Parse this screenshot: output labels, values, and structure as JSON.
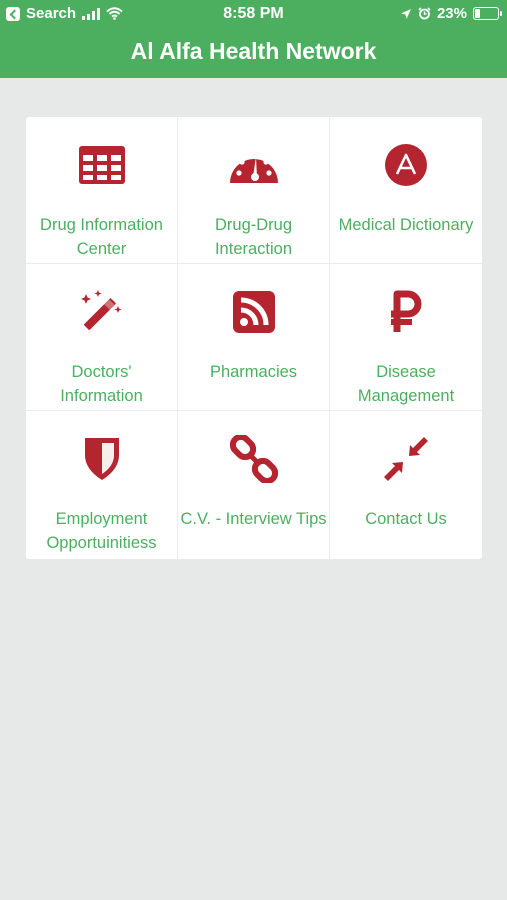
{
  "status_bar": {
    "back_label": "Search",
    "time": "8:58 PM",
    "battery": "23%",
    "battery_level": 0.23
  },
  "header": {
    "title": "Al Alfa Health Network"
  },
  "colors": {
    "accent": "#4caf5f",
    "icon": "#b5252f",
    "background": "#e6e9e8"
  },
  "tiles": [
    {
      "label": "Drug Information\nCenter",
      "icon": "table-icon"
    },
    {
      "label": "Drug-Drug\nInteraction",
      "icon": "dashboard-icon"
    },
    {
      "label": "Medical Dictionary",
      "icon": "angular-icon"
    },
    {
      "label": "Doctors'\nInformation",
      "icon": "magic-wand-icon"
    },
    {
      "label": "Pharmacies",
      "icon": "rss-icon"
    },
    {
      "label": "Disease\nManagement",
      "icon": "ruble-icon"
    },
    {
      "label": "Employment\nOpportuinitiess",
      "icon": "shield-icon"
    },
    {
      "label": "C.V. - Interview Tips",
      "icon": "chain-link-icon"
    },
    {
      "label": "Contact Us",
      "icon": "compress-icon"
    }
  ]
}
